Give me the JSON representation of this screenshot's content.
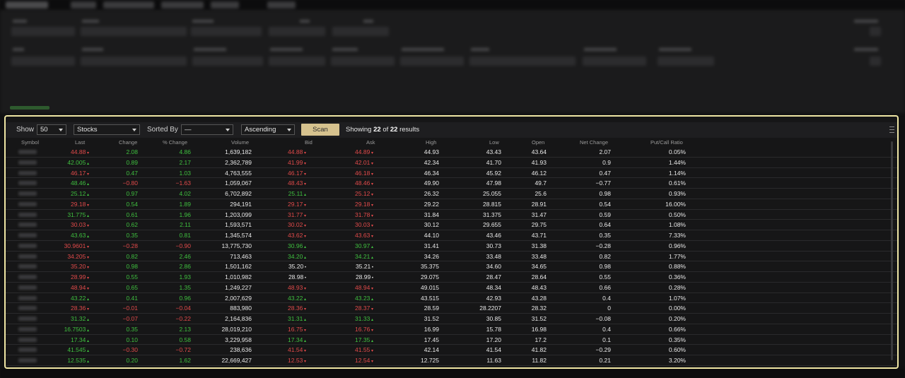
{
  "toolbar": {
    "show_label": "Show",
    "show_value": "50",
    "type_value": "Stocks",
    "sorted_label": "Sorted By",
    "sorted_value": "—",
    "order_value": "Ascending",
    "scan_label": "Scan",
    "results_prefix": "Showing",
    "results_shown": "22",
    "results_of": "of",
    "results_total": "22",
    "results_suffix": "results"
  },
  "columns": [
    "Symbol",
    "Last",
    "Change",
    "% Change",
    "Volume",
    "Bid",
    "Ask",
    "High",
    "Low",
    "Open",
    "Net Change",
    "Put/Call Ratio"
  ],
  "rows": [
    {
      "last": "44.88",
      "ld": "dn",
      "change": "2.08",
      "pct": "4.86",
      "cd": "up",
      "volume": "1,639,182",
      "bid": "44.88",
      "bd": "dn",
      "ask": "44.89",
      "ad": "dn",
      "high": "44.93",
      "low": "43.43",
      "open": "43.64",
      "net": "2.07",
      "pcr": "0.05%"
    },
    {
      "last": "42.005",
      "ld": "up",
      "change": "0.89",
      "pct": "2.17",
      "cd": "up",
      "volume": "2,362,789",
      "bid": "41.99",
      "bd": "dn",
      "ask": "42.01",
      "ad": "dn",
      "high": "42.34",
      "low": "41.70",
      "open": "41.93",
      "net": "0.9",
      "pcr": "1.44%"
    },
    {
      "last": "46.17",
      "ld": "dn",
      "change": "0.47",
      "pct": "1.03",
      "cd": "up",
      "volume": "4,763,555",
      "bid": "46.17",
      "bd": "dn",
      "ask": "46.18",
      "ad": "dn",
      "high": "46.34",
      "low": "45.92",
      "open": "46.12",
      "net": "0.47",
      "pcr": "1.14%"
    },
    {
      "last": "48.46",
      "ld": "up",
      "change": "−0.80",
      "pct": "−1.63",
      "cd": "dn",
      "volume": "1,059,067",
      "bid": "48.43",
      "bd": "dn",
      "ask": "48.46",
      "ad": "dn",
      "high": "49.90",
      "low": "47.98",
      "open": "49.7",
      "net": "−0.77",
      "pcr": "0.61%"
    },
    {
      "last": "25.12",
      "ld": "up",
      "change": "0.97",
      "pct": "4.02",
      "cd": "up",
      "volume": "6,702,892",
      "bid": "25.11",
      "bd": "up",
      "ask": "25.12",
      "ad": "dn",
      "high": "26.32",
      "low": "25.055",
      "open": "25.6",
      "net": "0.98",
      "pcr": "0.93%"
    },
    {
      "last": "29.18",
      "ld": "dn",
      "change": "0.54",
      "pct": "1.89",
      "cd": "up",
      "volume": "294,191",
      "bid": "29.17",
      "bd": "dn",
      "ask": "29.18",
      "ad": "dn",
      "high": "29.22",
      "low": "28.815",
      "open": "28.91",
      "net": "0.54",
      "pcr": "16.00%"
    },
    {
      "last": "31.775",
      "ld": "up",
      "change": "0.61",
      "pct": "1.96",
      "cd": "up",
      "volume": "1,203,099",
      "bid": "31.77",
      "bd": "dn",
      "ask": "31.78",
      "ad": "dn",
      "high": "31.84",
      "low": "31.375",
      "open": "31.47",
      "net": "0.59",
      "pcr": "0.50%"
    },
    {
      "last": "30.03",
      "ld": "dn",
      "change": "0.62",
      "pct": "2.11",
      "cd": "up",
      "volume": "1,593,571",
      "bid": "30.02",
      "bd": "dn",
      "ask": "30.03",
      "ad": "dn",
      "high": "30.12",
      "low": "29.655",
      "open": "29.75",
      "net": "0.64",
      "pcr": "1.08%"
    },
    {
      "last": "43.63",
      "ld": "up",
      "change": "0.35",
      "pct": "0.81",
      "cd": "up",
      "volume": "1,345,574",
      "bid": "43.62",
      "bd": "dn",
      "ask": "43.63",
      "ad": "dn",
      "high": "44.10",
      "low": "43.46",
      "open": "43.71",
      "net": "0.35",
      "pcr": "7.33%"
    },
    {
      "last": "30.9601",
      "ld": "dn",
      "change": "−0.28",
      "pct": "−0.90",
      "cd": "dn",
      "volume": "13,775,730",
      "bid": "30.96",
      "bd": "up",
      "ask": "30.97",
      "ad": "up",
      "high": "31.41",
      "low": "30.73",
      "open": "31.38",
      "net": "−0.28",
      "pcr": "0.96%"
    },
    {
      "last": "34.205",
      "ld": "dn",
      "change": "0.82",
      "pct": "2.46",
      "cd": "up",
      "volume": "713,463",
      "bid": "34.20",
      "bd": "up",
      "ask": "34.21",
      "ad": "up",
      "high": "34.26",
      "low": "33.48",
      "open": "33.48",
      "net": "0.82",
      "pcr": "1.77%"
    },
    {
      "last": "35.20",
      "ld": "dn",
      "change": "0.98",
      "pct": "2.86",
      "cd": "up",
      "volume": "1,501,162",
      "bid": "35.20",
      "bd": "neu",
      "ask": "35.21",
      "ad": "neu",
      "high": "35.375",
      "low": "34.60",
      "open": "34.65",
      "net": "0.98",
      "pcr": "0.88%"
    },
    {
      "last": "28.99",
      "ld": "dn",
      "change": "0.55",
      "pct": "1.93",
      "cd": "up",
      "volume": "1,010,982",
      "bid": "28.98",
      "bd": "neu",
      "ask": "28.99",
      "ad": "neu",
      "high": "29.075",
      "low": "28.47",
      "open": "28.64",
      "net": "0.55",
      "pcr": "0.36%"
    },
    {
      "last": "48.94",
      "ld": "dn",
      "change": "0.65",
      "pct": "1.35",
      "cd": "up",
      "volume": "1,249,227",
      "bid": "48.93",
      "bd": "dn",
      "ask": "48.94",
      "ad": "dn",
      "high": "49.015",
      "low": "48.34",
      "open": "48.43",
      "net": "0.66",
      "pcr": "0.28%"
    },
    {
      "last": "43.22",
      "ld": "up",
      "change": "0.41",
      "pct": "0.96",
      "cd": "up",
      "volume": "2,007,629",
      "bid": "43.22",
      "bd": "up",
      "ask": "43.23",
      "ad": "up",
      "high": "43.515",
      "low": "42.93",
      "open": "43.28",
      "net": "0.4",
      "pcr": "1.07%"
    },
    {
      "last": "28.36",
      "ld": "dn",
      "change": "−0.01",
      "pct": "−0.04",
      "cd": "dn",
      "volume": "883,980",
      "bid": "28.36",
      "bd": "dn",
      "ask": "28.37",
      "ad": "dn",
      "high": "28.59",
      "low": "28.2207",
      "open": "28.32",
      "net": "0",
      "pcr": "0.00%"
    },
    {
      "last": "31.32",
      "ld": "up",
      "change": "−0.07",
      "pct": "−0.22",
      "cd": "dn",
      "volume": "2,164,836",
      "bid": "31.31",
      "bd": "up",
      "ask": "31.33",
      "ad": "up",
      "high": "31.52",
      "low": "30.85",
      "open": "31.52",
      "net": "−0.08",
      "pcr": "0.20%"
    },
    {
      "last": "16.7503",
      "ld": "up",
      "change": "0.35",
      "pct": "2.13",
      "cd": "up",
      "volume": "28,019,210",
      "bid": "16.75",
      "bd": "dn",
      "ask": "16.76",
      "ad": "dn",
      "high": "16.99",
      "low": "15.78",
      "open": "16.98",
      "net": "0.4",
      "pcr": "0.66%"
    },
    {
      "last": "17.34",
      "ld": "up",
      "change": "0.10",
      "pct": "0.58",
      "cd": "up",
      "volume": "3,229,958",
      "bid": "17.34",
      "bd": "up",
      "ask": "17.35",
      "ad": "up",
      "high": "17.45",
      "low": "17.20",
      "open": "17.2",
      "net": "0.1",
      "pcr": "0.35%"
    },
    {
      "last": "41.545",
      "ld": "up",
      "change": "−0.30",
      "pct": "−0.72",
      "cd": "dn",
      "volume": "238,636",
      "bid": "41.54",
      "bd": "dn",
      "ask": "41.55",
      "ad": "dn",
      "high": "42.14",
      "low": "41.54",
      "open": "41.82",
      "net": "−0.29",
      "pcr": "0.60%"
    },
    {
      "last": "12.535",
      "ld": "up",
      "change": "0.20",
      "pct": "1.62",
      "cd": "up",
      "volume": "22,669,427",
      "bid": "12.53",
      "bd": "dn",
      "ask": "12.54",
      "ad": "dn",
      "high": "12.725",
      "low": "11.63",
      "open": "11.82",
      "net": "0.21",
      "pcr": "3.20%"
    }
  ],
  "colors": {
    "highlight": "#efe6a4",
    "up": "#3fbf3f",
    "down": "#e04a4a",
    "scan_button": "#d6c28e"
  }
}
